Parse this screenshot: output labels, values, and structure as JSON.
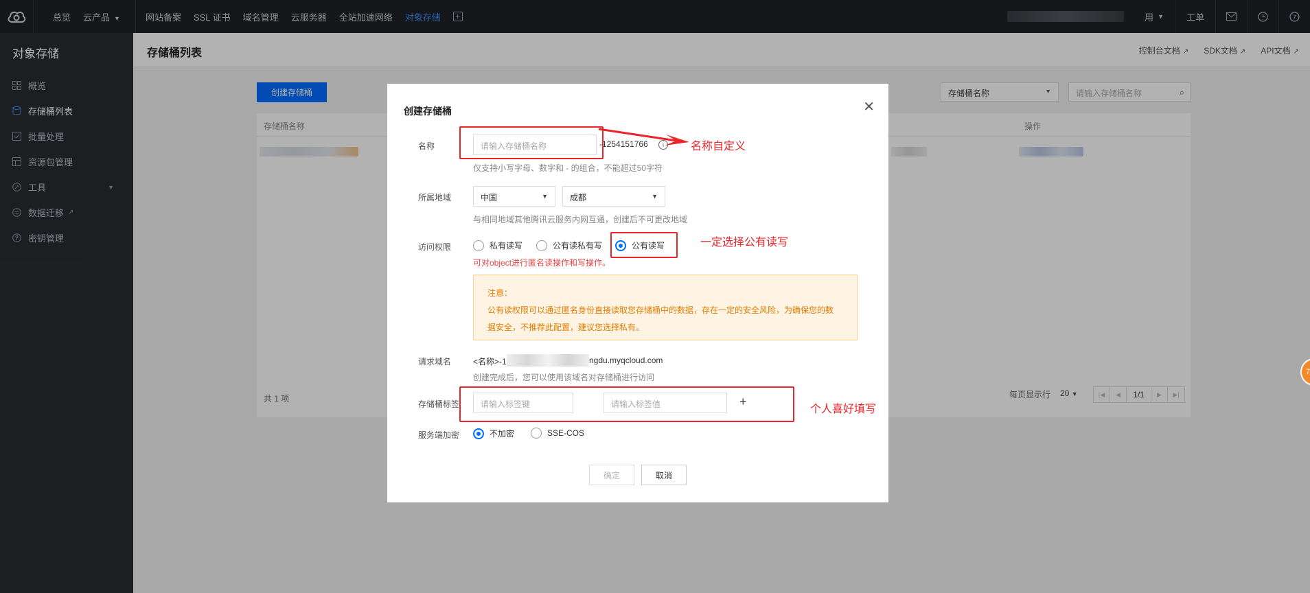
{
  "topnav": {
    "items": [
      "总览",
      "云产品",
      "网站备案",
      "SSL 证书",
      "域名管理",
      "云服务器",
      "全站加速网络",
      "对象存储"
    ],
    "right_items": [
      "用",
      "工单"
    ]
  },
  "sidebar": {
    "title": "对象存储",
    "items": [
      {
        "label": "概览",
        "icon": "grid-icon"
      },
      {
        "label": "存储桶列表",
        "icon": "bucket-icon"
      },
      {
        "label": "批量处理",
        "icon": "checkbox-icon"
      },
      {
        "label": "资源包管理",
        "icon": "package-icon"
      },
      {
        "label": "工具",
        "icon": "tool-icon"
      },
      {
        "label": "数据迁移",
        "icon": "migrate-icon"
      },
      {
        "label": "密钥管理",
        "icon": "key-icon"
      }
    ]
  },
  "main": {
    "page_title": "存储桶列表",
    "doc_links": [
      "控制台文档",
      "SDK文档",
      "API文档"
    ],
    "create_button": "创建存储桶",
    "search_select": "存储桶名称",
    "search_placeholder": "请输入存储桶名称",
    "col_name": "存储桶名称",
    "col_ops": "操作",
    "total": "共 1 项",
    "pager_label": "每页显示行",
    "pager_size": "20",
    "pager_page": "1/1"
  },
  "modal": {
    "title": "创建存储桶",
    "name_label": "名称",
    "name_placeholder": "请输入存储桶名称",
    "name_suffix": "-1254151766",
    "name_hint": "仅支持小写字母、数字和 - 的组合，不能超过50字符",
    "region_label": "所属地域",
    "region_country": "中国",
    "region_city": "成都",
    "region_hint": "与相同地域其他腾讯云服务内网互通，创建后不可更改地域",
    "access_label": "访问权限",
    "access_options": [
      "私有读写",
      "公有读私有写",
      "公有读写"
    ],
    "access_selected": 2,
    "access_warn": "可对object进行匿名读操作和写操作。",
    "notice_title": "注意：",
    "notice_line1": "公有读权限可以通过匿名身份直接读取您存储桶中的数据，存在一定的安全风险，为确保您的数",
    "notice_line2": "据安全，不推荐此配置，建议您选择私有。",
    "domain_label": "请求域名",
    "domain_prefix": "<名称>-1",
    "domain_suffix": "ngdu.myqcloud.com",
    "domain_hint": "创建完成后，您可以使用该域名对存储桶进行访问",
    "tag_label": "存储桶标签",
    "tag_key_placeholder": "请输入标签键",
    "tag_value_placeholder": "请输入标签值",
    "tag_add": "+",
    "encrypt_label": "服务端加密",
    "encrypt_options": [
      "不加密",
      "SSE-COS"
    ],
    "ok": "确定",
    "cancel": "取消"
  },
  "annotations": {
    "name": "名称自定义",
    "access": "一定选择公有读写",
    "tags": "个人喜好填写"
  },
  "badge": "7",
  "colors": {
    "primary": "#006eff",
    "annotation": "#e8262b",
    "nav_bg": "#1f2226",
    "sidebar_bg": "#292c31"
  }
}
